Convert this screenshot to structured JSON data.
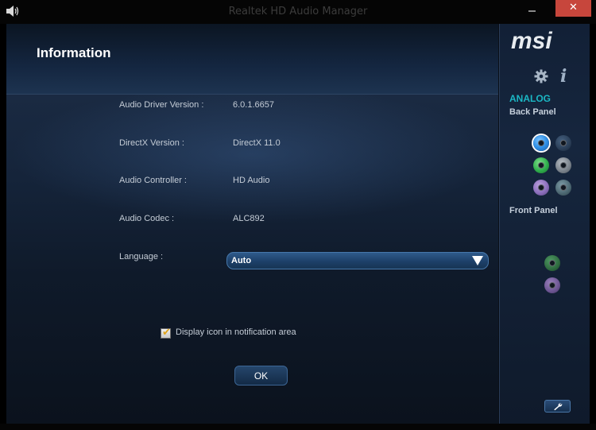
{
  "window": {
    "title": "Realtek HD Audio Manager",
    "close_label": "✕"
  },
  "header": {
    "title": "Information"
  },
  "info_rows": [
    {
      "label": "Audio Driver Version :",
      "value": "6.0.1.6657"
    },
    {
      "label": "DirectX Version :",
      "value": "DirectX 11.0"
    },
    {
      "label": "Audio Controller :",
      "value": "HD Audio"
    },
    {
      "label": "Audio Codec :",
      "value": "ALC892"
    }
  ],
  "language": {
    "label": "Language :",
    "selected": "Auto"
  },
  "notification": {
    "checked": true,
    "label": "Display icon in notification area"
  },
  "ok_label": "OK",
  "side_panel": {
    "brand": "msi",
    "analog_label": "ANALOG",
    "back_panel_label": "Back Panel",
    "front_panel_label": "Front Panel",
    "back_jacks": [
      "blue",
      "blue-dim",
      "green",
      "grey",
      "purple",
      "teal-dim"
    ],
    "front_jacks": [
      "green-dim",
      "purple-dim"
    ]
  },
  "colors": {
    "accent_teal": "#1bb7c4",
    "close_red": "#c7463c",
    "select_blue": "#1d4069"
  }
}
